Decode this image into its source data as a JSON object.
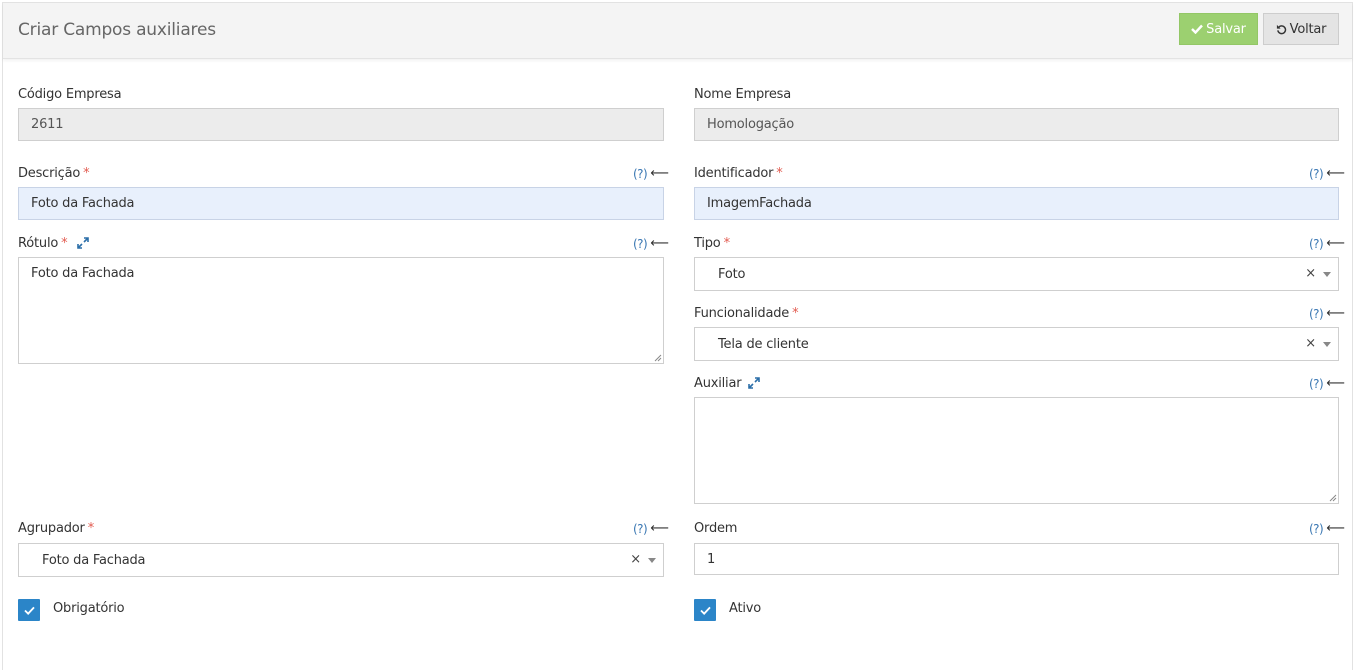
{
  "header": {
    "title": "Criar Campos auxiliares",
    "save_label": "Salvar",
    "back_label": "Voltar"
  },
  "help": {
    "question": "(?)",
    "arrow": "⟵"
  },
  "required_mark": "*",
  "form": {
    "codigo_empresa": {
      "label": "Código Empresa",
      "value": "2611"
    },
    "nome_empresa": {
      "label": "Nome Empresa",
      "value": "Homologação"
    },
    "descricao": {
      "label": "Descrição",
      "value": "Foto da Fachada"
    },
    "identificador": {
      "label": "Identificador",
      "value": "ImagemFachada"
    },
    "rotulo": {
      "label": "Rótulo",
      "value": "Foto da Fachada"
    },
    "tipo": {
      "label": "Tipo",
      "value": "Foto"
    },
    "funcionalidade": {
      "label": "Funcionalidade",
      "value": "Tela de cliente"
    },
    "auxiliar": {
      "label": "Auxiliar",
      "value": ""
    },
    "agrupador": {
      "label": "Agrupador",
      "value": "Foto da Fachada"
    },
    "ordem": {
      "label": "Ordem",
      "value": "1"
    },
    "obrigatorio": {
      "label": "Obrigatório",
      "checked": true
    },
    "ativo": {
      "label": "Ativo",
      "checked": true
    }
  },
  "icons": {
    "save": "check-icon",
    "back": "undo-icon",
    "expand": "expand-icon",
    "clear": "×"
  },
  "colors": {
    "save_button": "#9cd070",
    "checkbox": "#2b85c8",
    "required": "#e25a4f",
    "help_link": "#3b78b3",
    "focused_field": "#e8f0fc"
  }
}
